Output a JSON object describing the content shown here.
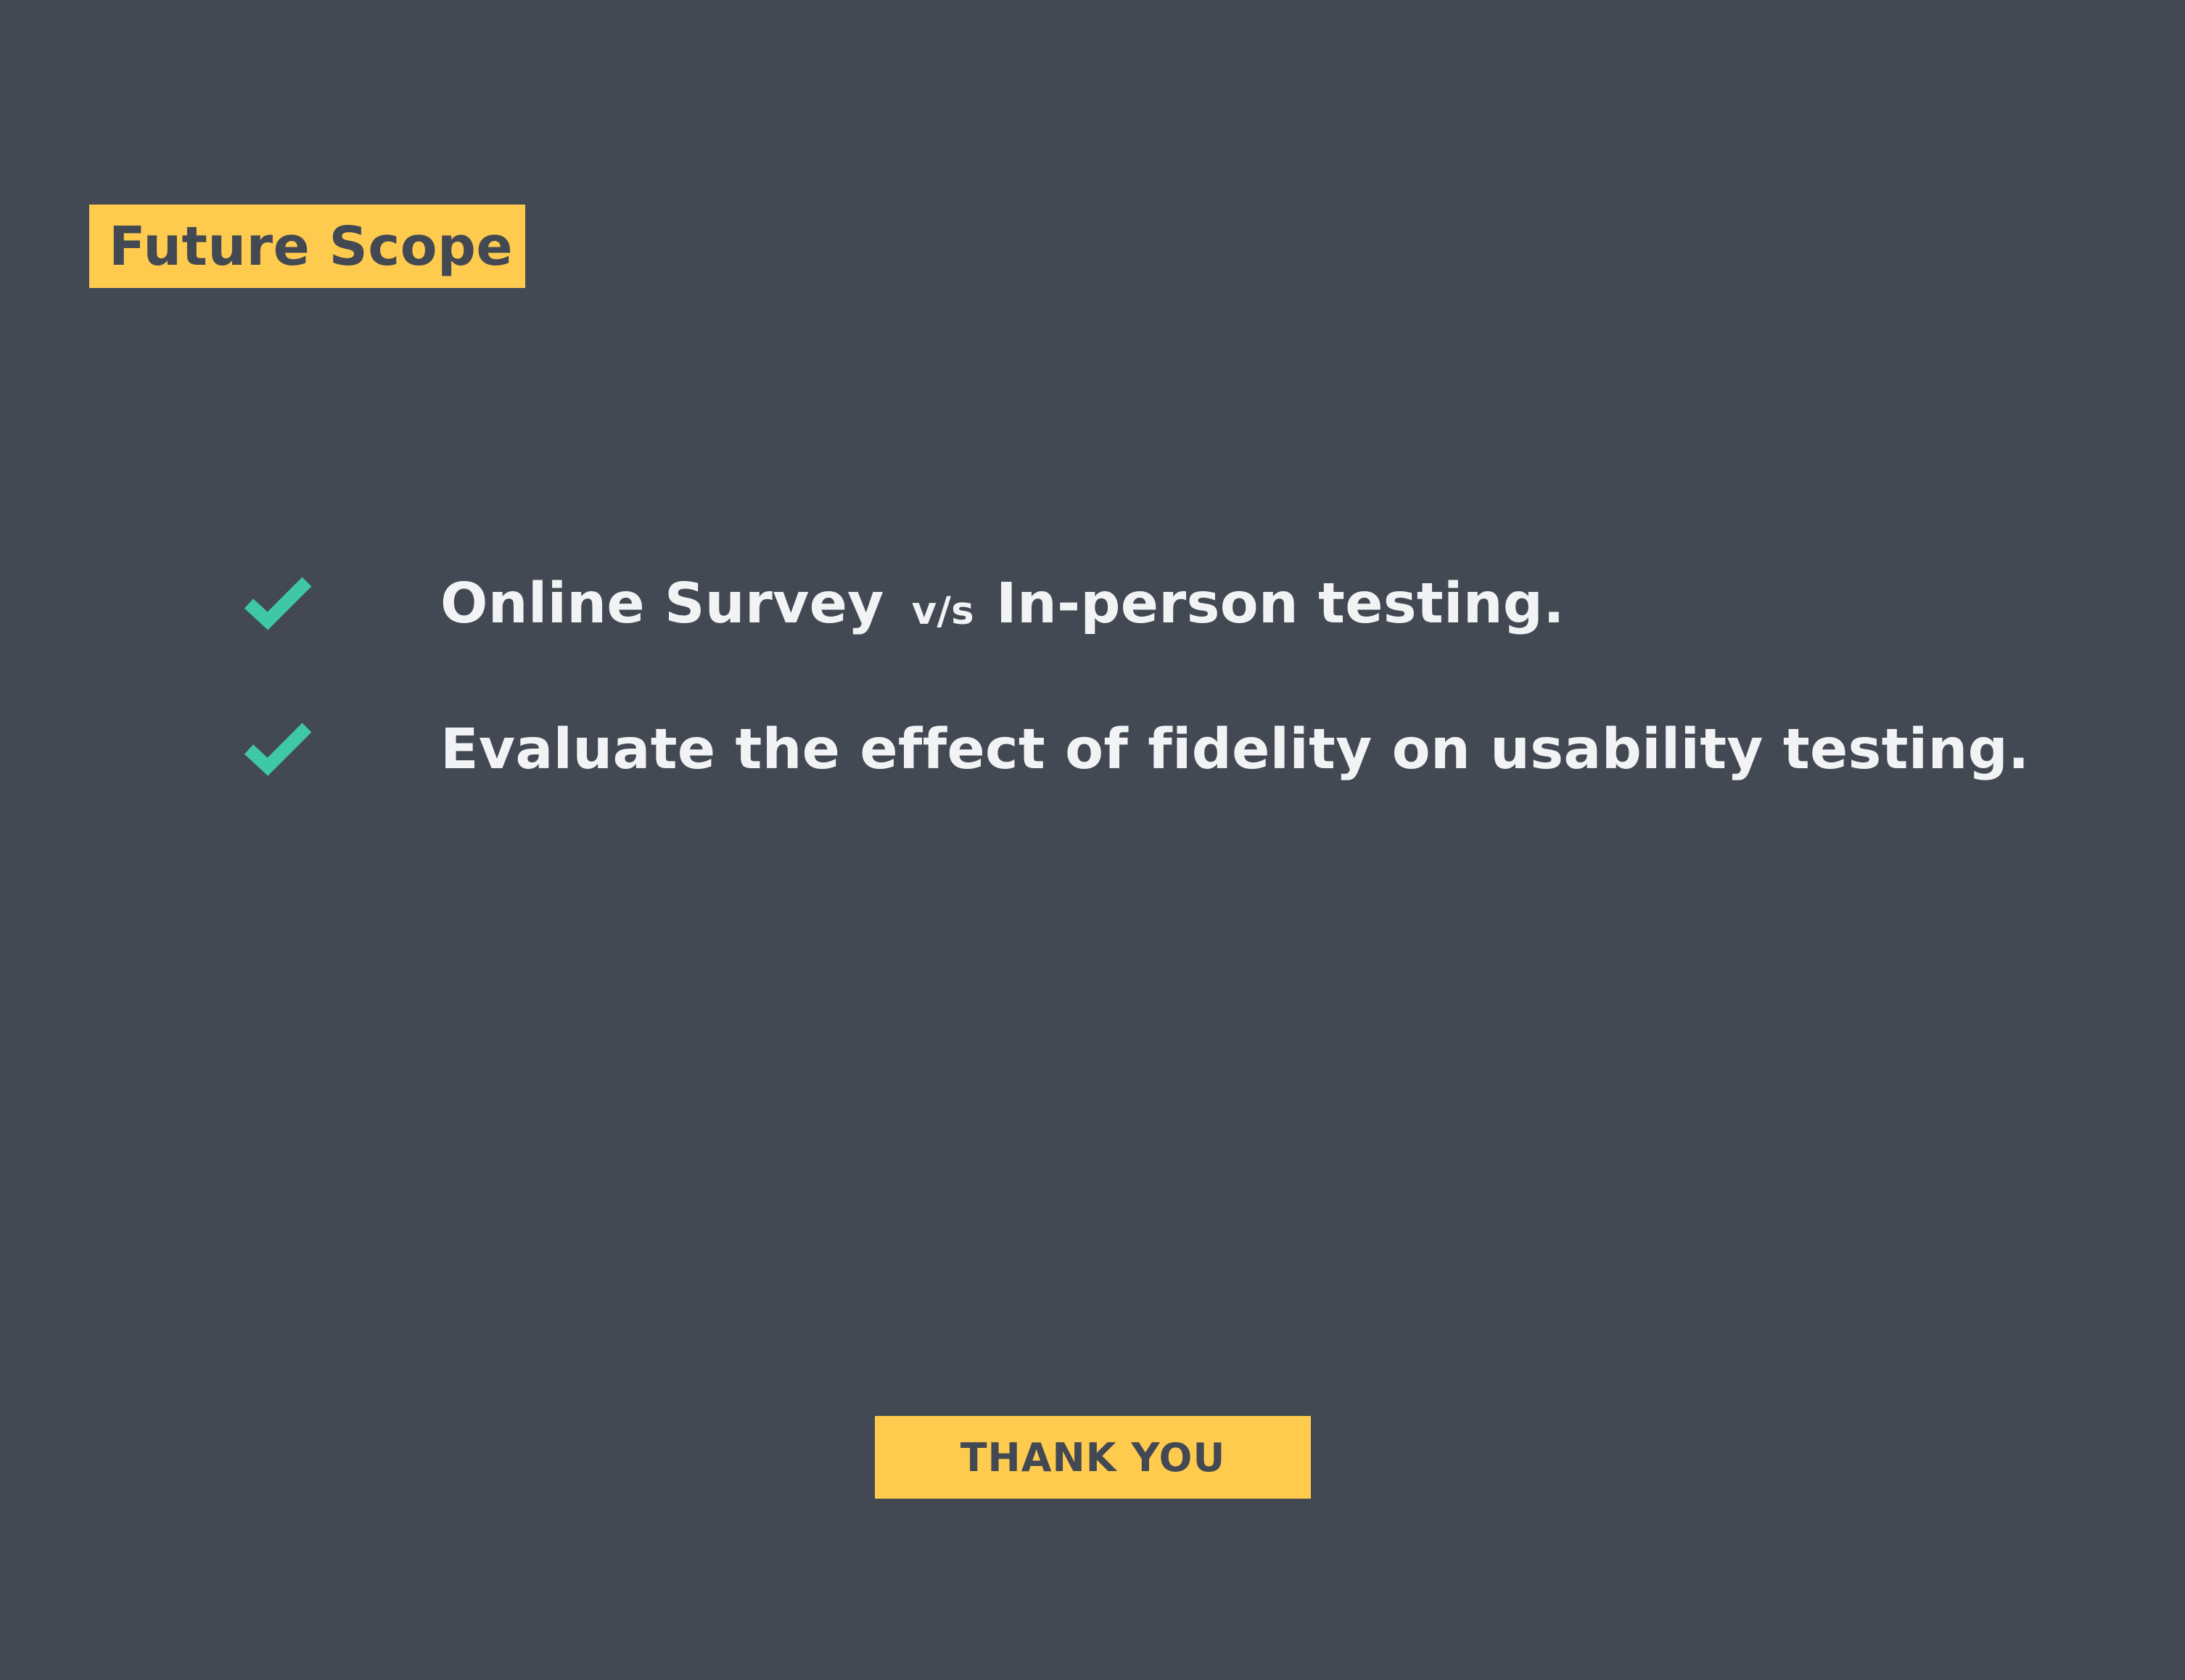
{
  "slide": {
    "title": "Future Scope",
    "bullets": [
      {
        "icon": "check-icon",
        "text_before": "Online Survey",
        "connector": "v/s",
        "text_after": "In-person testing."
      },
      {
        "icon": "check-icon",
        "text": "Evaluate the effect of fidelity on usability testing."
      }
    ],
    "footer": "THANK YOU"
  },
  "colors": {
    "background": "#434953",
    "accent": "#FECB4E",
    "check": "#3FC8A5",
    "text": "#F2F3F5"
  }
}
